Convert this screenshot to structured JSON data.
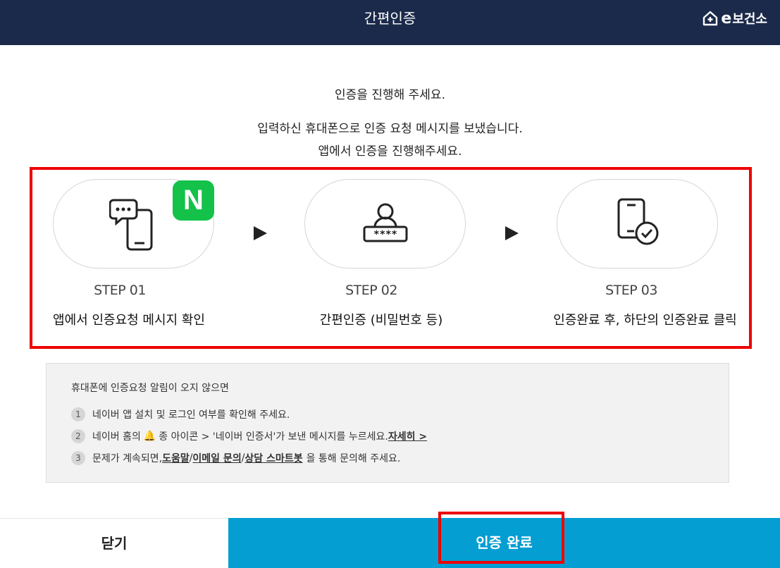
{
  "header": {
    "title": "간편인증",
    "brand": "보건소",
    "brand_prefix": "e"
  },
  "intro": {
    "line1": "인증을 진행해 주세요.",
    "line2": "입력하신 휴대폰으로 인증 요청 메시지를 보냈습니다.",
    "line3": "앱에서 인증을 진행해주세요."
  },
  "steps": [
    {
      "label": "STEP 01",
      "desc": "앱에서 인증요청 메시지 확인",
      "icon": "chat-phone-icon",
      "badge": "N"
    },
    {
      "label": "STEP 02",
      "desc": "간편인증 (비밀번호 등)",
      "icon": "user-password-icon"
    },
    {
      "label": "STEP 03",
      "desc": "인증완료 후, 하단의 인증완료 클릭",
      "icon": "phone-check-icon"
    }
  ],
  "notice": {
    "title": "휴대폰에 인증요청 알림이 오지 않으면",
    "item1": {
      "num": "1",
      "text": "네이버 앱 설치 및 로그인 여부를 확인해 주세요."
    },
    "item2": {
      "num": "2",
      "pre": "네이버 홈의",
      "bell": "🔔",
      "post": "종 아이콘 > '네이버 인증서'가 보낸 메시지를 누르세요.",
      "link": "자세히 >"
    },
    "item3": {
      "num": "3",
      "pre": "문제가 계속되면,",
      "link_help": "도움말",
      "sep1": "/",
      "link_email": "이메일 문의",
      "sep2": "/",
      "link_chatbot": "상담 스마트봇",
      "post": "을 통해 문의해 주세요."
    }
  },
  "buttons": {
    "close": "닫기",
    "done": "인증 완료"
  },
  "colors": {
    "header_bg": "#1b2a4a",
    "primary": "#049ed2",
    "naver_green": "#14c24a",
    "highlight_red": "#ee0000"
  }
}
